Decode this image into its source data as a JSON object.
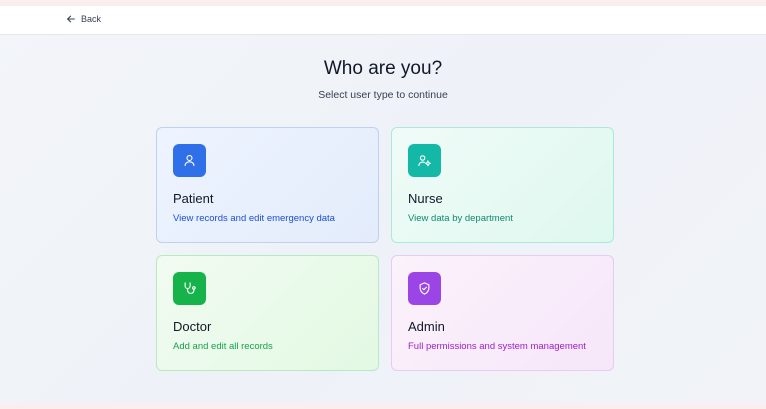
{
  "header": {
    "back_label": "Back"
  },
  "main": {
    "title": "Who are you?",
    "subtitle": "Select user type to continue"
  },
  "cards": [
    {
      "title": "Patient",
      "description": "View records and edit emergency data",
      "icon": "user-icon",
      "icon_color": "#2f6fe8",
      "desc_color": "#1d4ed8"
    },
    {
      "title": "Nurse",
      "description": "View data by department",
      "icon": "user-cog-icon",
      "icon_color": "#14b8a6",
      "desc_color": "#0f8a6f"
    },
    {
      "title": "Doctor",
      "description": "Add and edit all records",
      "icon": "stethoscope-icon",
      "icon_color": "#16b34a",
      "desc_color": "#16a34a"
    },
    {
      "title": "Admin",
      "description": "Full permissions and system management",
      "icon": "shield-check-icon",
      "icon_color": "#9b45e6",
      "desc_color": "#9b1fc9"
    }
  ]
}
